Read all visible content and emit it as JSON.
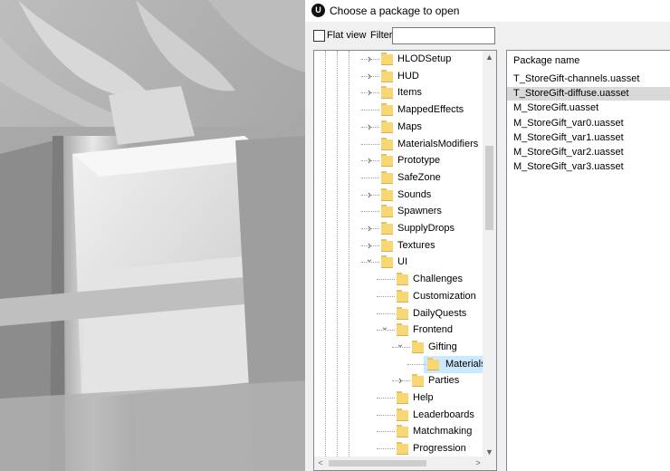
{
  "dialog": {
    "title": "Choose a package to open",
    "logo_glyph": "U",
    "flat_view_label": "Flat view",
    "flat_view_checked": false,
    "filter_label": "Filter:",
    "filter_value": ""
  },
  "tree": {
    "items": [
      {
        "label": "HLODSetup",
        "depth": 0,
        "expander": "collapsed"
      },
      {
        "label": "HUD",
        "depth": 0,
        "expander": "collapsed"
      },
      {
        "label": "Items",
        "depth": 0,
        "expander": "collapsed"
      },
      {
        "label": "MappedEffects",
        "depth": 0,
        "expander": "none"
      },
      {
        "label": "Maps",
        "depth": 0,
        "expander": "collapsed"
      },
      {
        "label": "MaterialsModifiers",
        "depth": 0,
        "expander": "none"
      },
      {
        "label": "Prototype",
        "depth": 0,
        "expander": "collapsed"
      },
      {
        "label": "SafeZone",
        "depth": 0,
        "expander": "none"
      },
      {
        "label": "Sounds",
        "depth": 0,
        "expander": "collapsed"
      },
      {
        "label": "Spawners",
        "depth": 0,
        "expander": "none"
      },
      {
        "label": "SupplyDrops",
        "depth": 0,
        "expander": "collapsed"
      },
      {
        "label": "Textures",
        "depth": 0,
        "expander": "collapsed"
      },
      {
        "label": "UI",
        "depth": 0,
        "expander": "expanded"
      },
      {
        "label": "Challenges",
        "depth": 1,
        "expander": "none"
      },
      {
        "label": "Customization",
        "depth": 1,
        "expander": "none"
      },
      {
        "label": "DailyQuests",
        "depth": 1,
        "expander": "none"
      },
      {
        "label": "Frontend",
        "depth": 1,
        "expander": "expanded"
      },
      {
        "label": "Gifting",
        "depth": 2,
        "expander": "expanded"
      },
      {
        "label": "Materials",
        "depth": 3,
        "expander": "none",
        "selected": true
      },
      {
        "label": "Parties",
        "depth": 2,
        "expander": "collapsed"
      },
      {
        "label": "Help",
        "depth": 1,
        "expander": "none"
      },
      {
        "label": "Leaderboards",
        "depth": 1,
        "expander": "none"
      },
      {
        "label": "Matchmaking",
        "depth": 1,
        "expander": "none"
      },
      {
        "label": "Progression",
        "depth": 1,
        "expander": "none"
      }
    ],
    "scroll_up_glyph": "▲",
    "scroll_down_glyph": "▼",
    "scroll_left_glyph": "<",
    "scroll_right_glyph": ">"
  },
  "packages": {
    "header": "Package name",
    "items": [
      {
        "name": "T_StoreGift-channels.uasset"
      },
      {
        "name": "T_StoreGift-diffuse.uasset",
        "selected": true
      },
      {
        "name": "M_StoreGift.uasset"
      },
      {
        "name": "M_StoreGift_var0.uasset"
      },
      {
        "name": "M_StoreGift_var1.uasset"
      },
      {
        "name": "M_StoreGift_var2.uasset"
      },
      {
        "name": "M_StoreGift_var3.uasset"
      }
    ]
  },
  "icons": {
    "expand": "›",
    "collapse": "⌄",
    "folder": "folder-icon"
  }
}
